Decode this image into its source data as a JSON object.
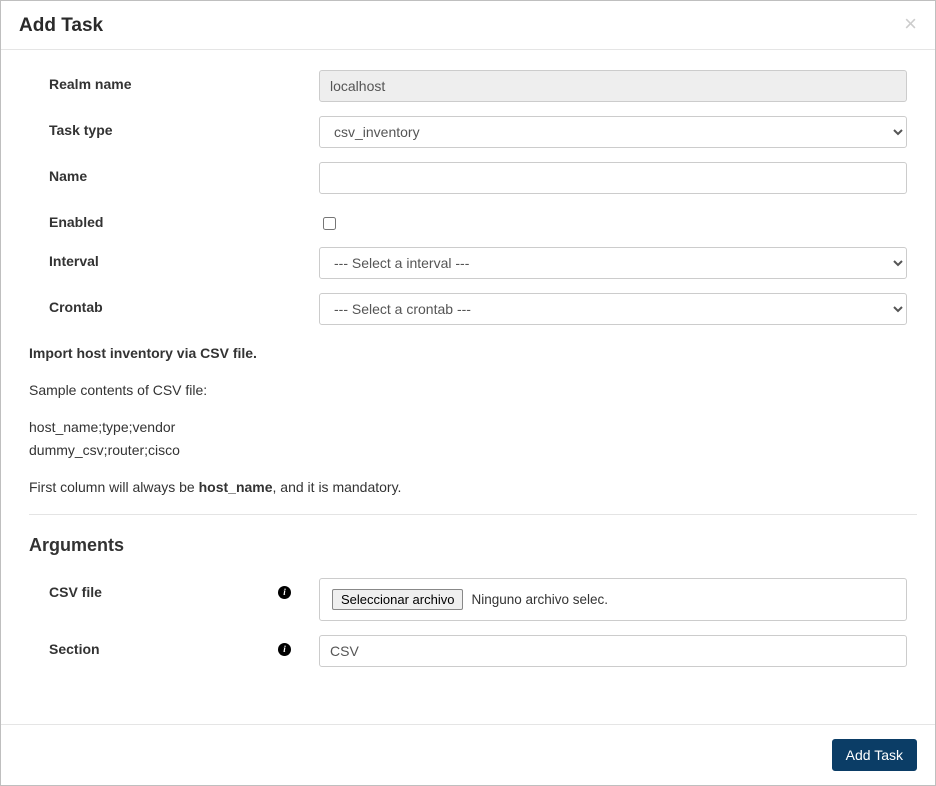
{
  "modal": {
    "title": "Add Task",
    "close_glyph": "×"
  },
  "form": {
    "realm": {
      "label": "Realm name",
      "value": "localhost"
    },
    "task_type": {
      "label": "Task type",
      "selected": "csv_inventory"
    },
    "name": {
      "label": "Name",
      "value": ""
    },
    "enabled": {
      "label": "Enabled",
      "checked": false
    },
    "interval": {
      "label": "Interval",
      "selected": "--- Select a interval ---"
    },
    "crontab": {
      "label": "Crontab",
      "selected": "--- Select a crontab ---"
    }
  },
  "description": {
    "line1": "Import host inventory via CSV file.",
    "line2": "Sample contents of CSV file:",
    "sample1": "host_name;type;vendor",
    "sample2": "dummy_csv;router;cisco",
    "line3a": "First column will always be ",
    "line3b": "host_name",
    "line3c": ", and it is mandatory."
  },
  "arguments": {
    "heading": "Arguments",
    "csv_file": {
      "label": "CSV file",
      "button": "Seleccionar archivo",
      "status": "Ninguno archivo selec."
    },
    "section": {
      "label": "Section",
      "value": "CSV"
    }
  },
  "footer": {
    "submit": "Add Task"
  }
}
